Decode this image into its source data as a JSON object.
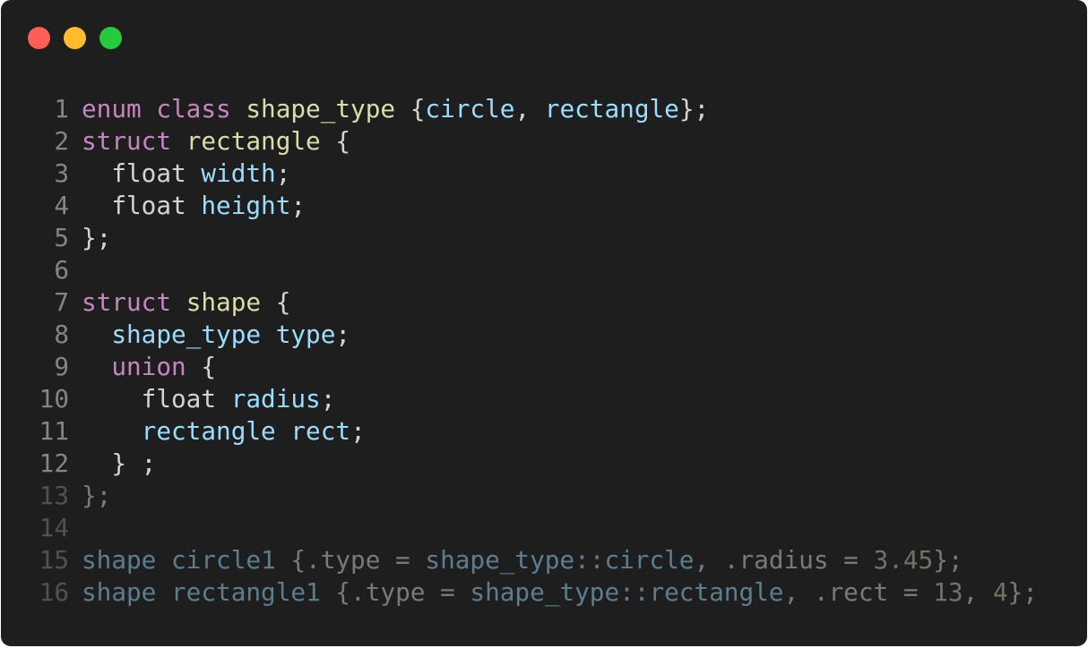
{
  "window": {
    "traffic_lights": [
      {
        "name": "close",
        "color": "#ff5f56"
      },
      {
        "name": "minimize",
        "color": "#ffbd2e"
      },
      {
        "name": "maximize",
        "color": "#27c93f"
      }
    ]
  },
  "colors": {
    "background": "#1e1e1e",
    "keyword": "#c586c0",
    "type": "#dcdcaa",
    "identifier": "#9cdcfe",
    "punctuation": "#d4d4d4",
    "line_number": "#858585",
    "number": "#b5cea8"
  },
  "code_lines": [
    {
      "number": "1",
      "dim": false,
      "tokens": [
        {
          "t": "enum class ",
          "c": "kw"
        },
        {
          "t": "shape_type ",
          "c": "ty"
        },
        {
          "t": "{",
          "c": "pn"
        },
        {
          "t": "circle",
          "c": "id"
        },
        {
          "t": ", ",
          "c": "pn"
        },
        {
          "t": "rectangle",
          "c": "id"
        },
        {
          "t": "};",
          "c": "pn"
        }
      ]
    },
    {
      "number": "2",
      "dim": false,
      "tokens": [
        {
          "t": "struct ",
          "c": "kw"
        },
        {
          "t": "rectangle ",
          "c": "ty"
        },
        {
          "t": "{",
          "c": "pn"
        }
      ]
    },
    {
      "number": "3",
      "dim": false,
      "tokens": [
        {
          "t": "  float ",
          "c": "pn"
        },
        {
          "t": "width",
          "c": "id"
        },
        {
          "t": ";",
          "c": "pn"
        }
      ]
    },
    {
      "number": "4",
      "dim": false,
      "tokens": [
        {
          "t": "  float ",
          "c": "pn"
        },
        {
          "t": "height",
          "c": "id"
        },
        {
          "t": ";",
          "c": "pn"
        }
      ]
    },
    {
      "number": "5",
      "dim": false,
      "tokens": [
        {
          "t": "};",
          "c": "pn"
        }
      ]
    },
    {
      "number": "6",
      "dim": false,
      "tokens": []
    },
    {
      "number": "7",
      "dim": false,
      "tokens": [
        {
          "t": "struct ",
          "c": "kw"
        },
        {
          "t": "shape ",
          "c": "ty"
        },
        {
          "t": "{",
          "c": "pn"
        }
      ]
    },
    {
      "number": "8",
      "dim": false,
      "tokens": [
        {
          "t": "  shape_type type",
          "c": "id"
        },
        {
          "t": ";",
          "c": "pn"
        }
      ]
    },
    {
      "number": "9",
      "dim": false,
      "tokens": [
        {
          "t": "  union ",
          "c": "kw"
        },
        {
          "t": "{",
          "c": "pn"
        }
      ]
    },
    {
      "number": "10",
      "dim": false,
      "tokens": [
        {
          "t": "    float ",
          "c": "pn"
        },
        {
          "t": "radius",
          "c": "id"
        },
        {
          "t": ";",
          "c": "pn"
        }
      ]
    },
    {
      "number": "11",
      "dim": false,
      "tokens": [
        {
          "t": "    rectangle rect",
          "c": "id"
        },
        {
          "t": ";",
          "c": "pn"
        }
      ]
    },
    {
      "number": "12",
      "dim": false,
      "tokens": [
        {
          "t": "  } ;",
          "c": "pn"
        }
      ]
    },
    {
      "number": "13",
      "dim": true,
      "tokens": [
        {
          "t": "};",
          "c": "pn"
        }
      ]
    },
    {
      "number": "14",
      "dim": true,
      "tokens": []
    },
    {
      "number": "15",
      "dim": true,
      "tokens": [
        {
          "t": "shape circle1 ",
          "c": "id"
        },
        {
          "t": "{.type = ",
          "c": "pn"
        },
        {
          "t": "shape_type::circle",
          "c": "id"
        },
        {
          "t": ", .radius = ",
          "c": "pn"
        },
        {
          "t": "3.45",
          "c": "num"
        },
        {
          "t": "};",
          "c": "pn"
        }
      ]
    },
    {
      "number": "16",
      "dim": true,
      "tokens": [
        {
          "t": "shape rectangle1 ",
          "c": "id"
        },
        {
          "t": "{.type = ",
          "c": "pn"
        },
        {
          "t": "shape_type::rectangle",
          "c": "id"
        },
        {
          "t": ", .rect = ",
          "c": "pn"
        },
        {
          "t": "13",
          "c": "num"
        },
        {
          "t": ", ",
          "c": "pn"
        },
        {
          "t": "4",
          "c": "num"
        },
        {
          "t": "};",
          "c": "pn"
        }
      ]
    }
  ]
}
